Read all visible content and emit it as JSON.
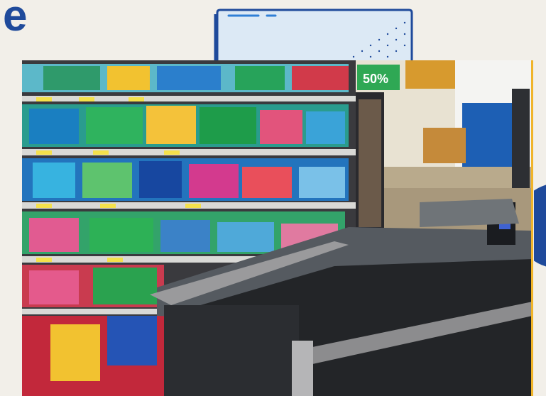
{
  "heading": {
    "fragment": "e"
  },
  "photo": {
    "subject": "",
    "sign_text": "50%"
  },
  "colors": {
    "brand_blue": "#1f4a9b",
    "accent_yellow": "#f0b429",
    "background": "#f2efe9",
    "card_fill": "#dce9f5"
  }
}
